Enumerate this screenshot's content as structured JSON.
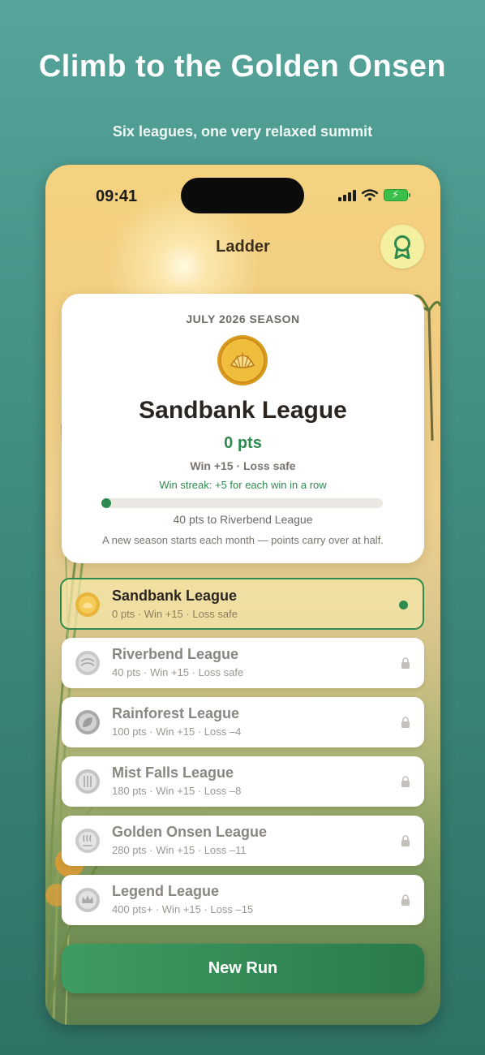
{
  "promo": {
    "title": "Climb to the Golden Onsen",
    "subtitle": "Six leagues, one very relaxed summit"
  },
  "status_bar": {
    "time": "09:41",
    "icons": [
      "signal-icon",
      "wifi-icon",
      "battery-charging-icon"
    ]
  },
  "nav": {
    "title": "Ladder",
    "award_icon": "award-ribbon-icon"
  },
  "season": {
    "label": "JULY 2026 SEASON",
    "medal_icon": "shell-medal-icon",
    "league_name": "Sandbank League",
    "points": "0 pts",
    "rules": "Win +15 · Loss safe",
    "streak": "Win streak: +5 for each win in a row",
    "progress_fraction": 0.0,
    "progress_text": "40 pts to Riverbend League",
    "note": "A new season starts each month — points carry over at half."
  },
  "leagues": [
    {
      "name": "Sandbank League",
      "meta": "0 pts  ·  Win +15 · Loss safe",
      "status": "current",
      "coin_icon": "shell-coin-icon"
    },
    {
      "name": "Riverbend League",
      "meta": "40 pts  ·  Win +15 · Loss safe",
      "status": "locked",
      "coin_icon": "river-coin-icon"
    },
    {
      "name": "Rainforest League",
      "meta": "100 pts  ·  Win +15 · Loss –4",
      "status": "locked",
      "coin_icon": "leaf-coin-icon"
    },
    {
      "name": "Mist Falls League",
      "meta": "180 pts  ·  Win +15 · Loss –8",
      "status": "locked",
      "coin_icon": "waterfall-coin-icon"
    },
    {
      "name": "Golden Onsen League",
      "meta": "280 pts  ·  Win +15 · Loss –11",
      "status": "locked",
      "coin_icon": "onsen-coin-icon"
    },
    {
      "name": "Legend League",
      "meta": "400 pts+  ·  Win +15 · Loss –15",
      "status": "locked",
      "coin_icon": "crown-coin-icon"
    }
  ],
  "cta": {
    "label": "New Run"
  },
  "colors": {
    "accent": "#2e8a4e",
    "background_top": "#56a49a",
    "gold": "#e8b53a"
  }
}
